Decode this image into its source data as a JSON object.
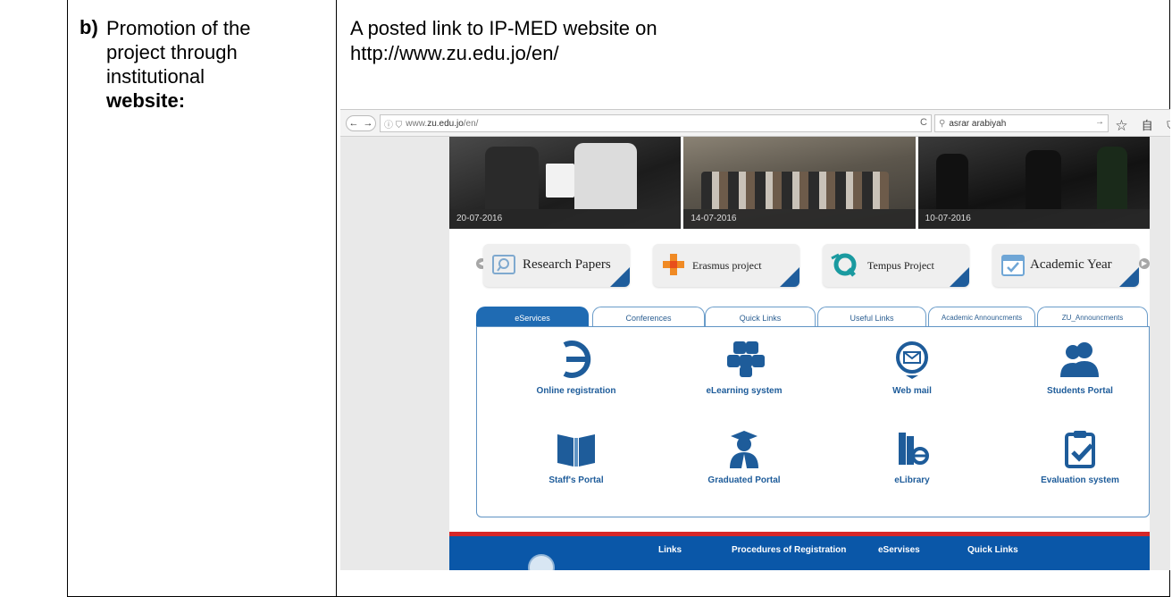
{
  "document": {
    "item_marker": "b)",
    "item_text_lines": [
      "Promotion of the",
      "project through",
      "institutional"
    ],
    "item_text_bold": "website:",
    "description_lines": [
      "A posted link to IP-MED website  on",
      "http://www.zu.edu.jo/en/"
    ]
  },
  "browser": {
    "url_prefix": "www.",
    "url_host": "zu.edu.jo",
    "url_path": "/en/",
    "search_value": "asrar arabiyah",
    "nav_back": "←",
    "nav_forward": "→",
    "reload": "C",
    "search_go": "→",
    "toolbar_icons": "☆ 自 ⛉"
  },
  "photos": [
    {
      "date": "20-07-2016"
    },
    {
      "date": "14-07-2016"
    },
    {
      "date": "10-07-2016"
    }
  ],
  "projects": [
    {
      "label": "Research Papers",
      "icon": "magnifier-book-icon"
    },
    {
      "label": "Erasmus project",
      "icon": "erasmus-cross-icon"
    },
    {
      "label": "Tempus Project",
      "icon": "tempus-logo-icon"
    },
    {
      "label": "Academic Year",
      "icon": "calendar-check-icon"
    }
  ],
  "tabs": [
    "eServices",
    "Conferences",
    "Quick Links",
    "Useful Links",
    "Academic Announcments",
    "ZU_Announcments"
  ],
  "services": [
    {
      "label": "Online registration",
      "icon": "registration-e-icon"
    },
    {
      "label": "eLearning system",
      "icon": "elearning-cubes-icon"
    },
    {
      "label": "Web mail",
      "icon": "mail-pin-icon"
    },
    {
      "label": "Students Portal",
      "icon": "students-icon"
    },
    {
      "label": "Staff's Portal",
      "icon": "book-icon"
    },
    {
      "label": "Graduated Portal",
      "icon": "graduate-icon"
    },
    {
      "label": "eLibrary",
      "icon": "library-icon"
    },
    {
      "label": "Evaluation system",
      "icon": "clipboard-check-icon"
    }
  ],
  "footer": {
    "links": [
      "Links",
      "Procedures of Registration",
      "eServises",
      "Quick Links"
    ]
  },
  "colors": {
    "brand_blue": "#1f6bb3",
    "link_blue": "#1e5c9a",
    "footer_blue": "#0a57a8",
    "footer_red": "#d62728",
    "teal": "#1a9aa0"
  }
}
